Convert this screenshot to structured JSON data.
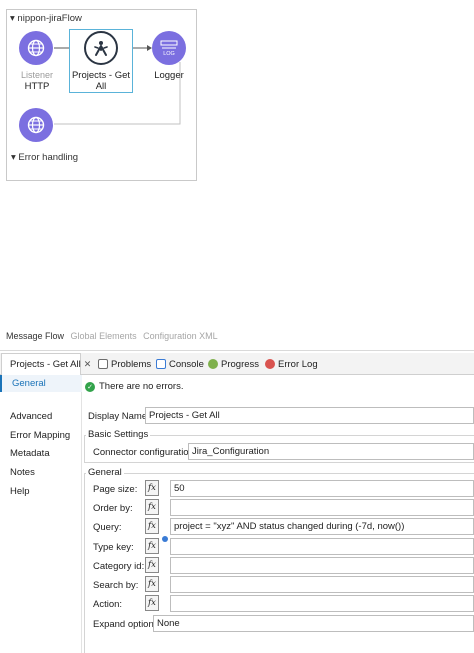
{
  "flow": {
    "title": "nippon-jiraFlow",
    "listener": {
      "sub": "Listener",
      "label": "HTTP"
    },
    "jira": {
      "label": "Projects - Get All"
    },
    "logger": {
      "label": "Logger"
    },
    "error_handling": "Error handling"
  },
  "editor_tabs": [
    "Message Flow",
    "Global Elements",
    "Configuration XML"
  ],
  "view_tabs": {
    "properties": "Projects - Get All",
    "problems": "Problems",
    "console": "Console",
    "progress": "Progress",
    "error_log": "Error Log"
  },
  "side_nav": [
    "General",
    "Advanced",
    "Error Mapping",
    "Metadata",
    "Notes",
    "Help"
  ],
  "status": "There are no errors.",
  "display_name": {
    "label": "Display Name:",
    "value": "Projects - Get All"
  },
  "basic_settings": {
    "title": "Basic Settings",
    "connector_label": "Connector configuration:",
    "connector_value": "Jira_Configuration"
  },
  "general": {
    "title": "General",
    "fx": "fx",
    "fields": [
      {
        "label": "Page size:",
        "value": "50"
      },
      {
        "label": "Order by:",
        "value": ""
      },
      {
        "label": "Query:",
        "value": "project = \"xyz\" AND status changed during (-7d, now())"
      },
      {
        "label": "Type key:",
        "value": ""
      },
      {
        "label": "Category id:",
        "value": ""
      },
      {
        "label": "Search by:",
        "value": ""
      },
      {
        "label": "Action:",
        "value": ""
      }
    ],
    "expand_label": "Expand options",
    "expand_value": "None"
  },
  "colors": {
    "connector": "#7b6fe0",
    "selection": "#5ab3d9",
    "accent": "#1a73b8",
    "ok": "#32a34b"
  }
}
